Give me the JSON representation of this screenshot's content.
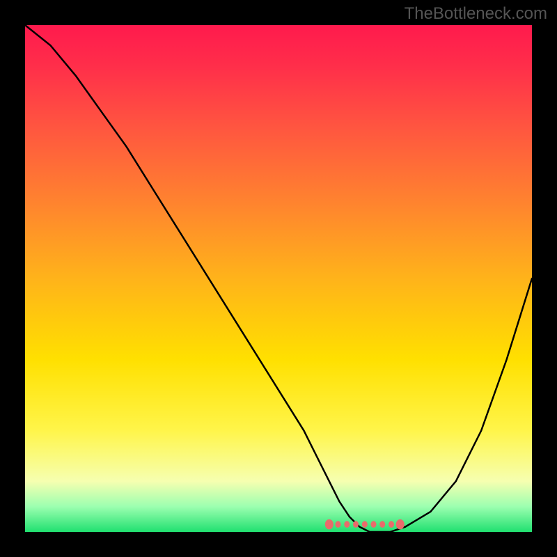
{
  "attribution": "TheBottleneck.com",
  "chart_data": {
    "type": "line",
    "title": "",
    "xlabel": "",
    "ylabel": "",
    "xlim": [
      0,
      100
    ],
    "ylim": [
      0,
      100
    ],
    "series": [
      {
        "name": "bottleneck-curve",
        "x": [
          0,
          5,
          10,
          15,
          20,
          25,
          30,
          35,
          40,
          45,
          50,
          55,
          58,
          60,
          62,
          64,
          66,
          68,
          70,
          72,
          75,
          80,
          85,
          90,
          95,
          100
        ],
        "y": [
          100,
          96,
          90,
          83,
          76,
          68,
          60,
          52,
          44,
          36,
          28,
          20,
          14,
          10,
          6,
          3,
          1,
          0,
          0,
          0,
          1,
          4,
          10,
          20,
          34,
          50
        ]
      }
    ],
    "optimal_zone": {
      "x_start": 60,
      "x_end": 74,
      "y": 1.5
    },
    "colors": {
      "gradient_top": "#ff1a4d",
      "gradient_bottom": "#20e070",
      "curve": "#000000",
      "marker": "#e96b6b"
    }
  }
}
